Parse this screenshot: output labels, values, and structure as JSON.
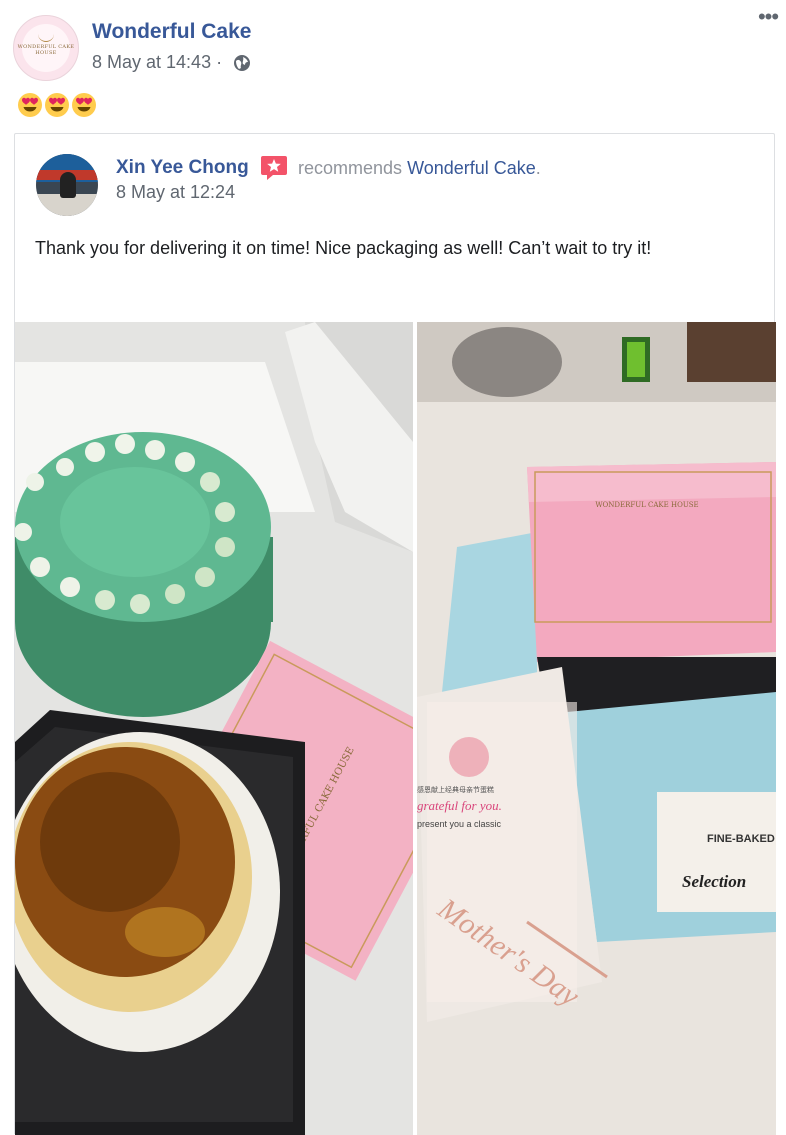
{
  "post": {
    "page_name": "Wonderful Cake",
    "timestamp": "8 May at 14:43",
    "separator": " · ",
    "privacy_icon": "globe-icon",
    "more_label": "•••",
    "emojis": [
      "heart-eyes-emoji",
      "heart-eyes-emoji",
      "heart-eyes-emoji"
    ]
  },
  "shared": {
    "reviewer_name": "Xin Yee Chong",
    "badge_icon": "recommend-star-icon",
    "recommends_word": "recommends",
    "recommends_target": "Wonderful Cake",
    "recommends_period": ".",
    "timestamp": "8 May at 12:24",
    "review_text": "Thank you for delivering it on time! Nice packaging as well! Can’t wait to try it!",
    "photos": [
      {
        "content": "pandan-cake-and-cheesecake-photo"
      },
      {
        "content": "gift-boxes-and-card-photo"
      }
    ],
    "photo_text": {
      "box_logo": "WONDERFUL CAKE HOUSE",
      "card_line1": "grateful for you.",
      "card_line2": "present you a classic",
      "card_cn": "感恩献上经典母亲节蛋糕",
      "box_fine": "FINE-BAKED",
      "box_selection": "Selection",
      "topper": "Mother's Day"
    }
  },
  "colors": {
    "link_blue": "#385898",
    "meta_gray": "#606770",
    "badge_pink": "#f35369",
    "box_pink": "#f2a9bc",
    "box_blue": "#9fd0dc",
    "cake_green": "#4fa57c"
  }
}
